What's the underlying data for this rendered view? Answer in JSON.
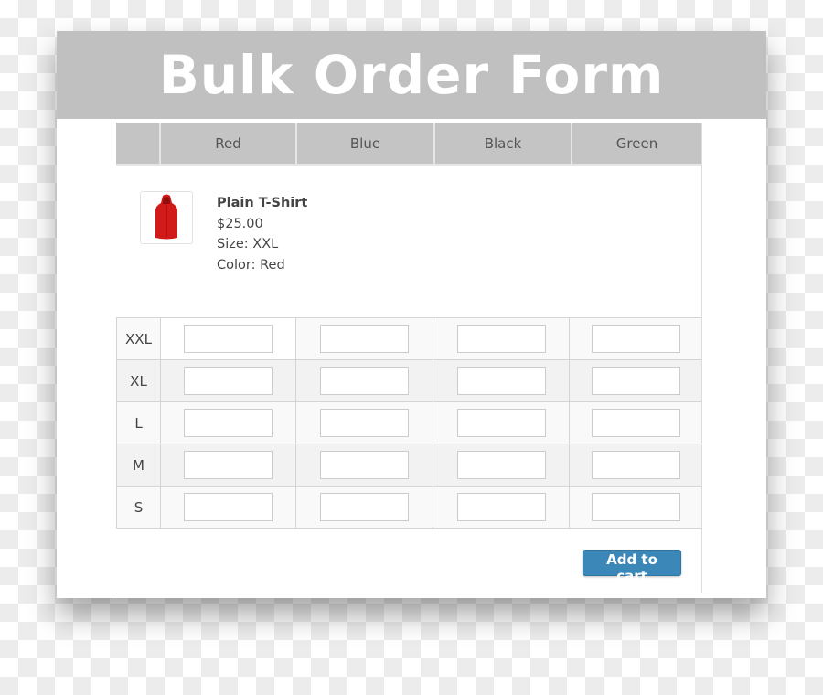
{
  "title": "Bulk Order Form",
  "columns": [
    "",
    "Red",
    "Blue",
    "Black",
    "Green"
  ],
  "product": {
    "image_icon": "red-hooded-vest",
    "name": "Plain T-Shirt",
    "price": "$25.00",
    "size": "Size: XXL",
    "color": "Color: Red"
  },
  "sizes": [
    {
      "label": "XXL",
      "values": [
        "",
        "",
        "",
        ""
      ]
    },
    {
      "label": "XL",
      "values": [
        "",
        "",
        "",
        ""
      ]
    },
    {
      "label": "L",
      "values": [
        "",
        "",
        "",
        ""
      ]
    },
    {
      "label": "M",
      "values": [
        "",
        "",
        "",
        ""
      ]
    },
    {
      "label": "S",
      "values": [
        "",
        "",
        "",
        ""
      ]
    }
  ],
  "add_to_cart_label": "Add to cart",
  "colors": {
    "header": "#c0c0c0",
    "button": "#3a87b8"
  }
}
